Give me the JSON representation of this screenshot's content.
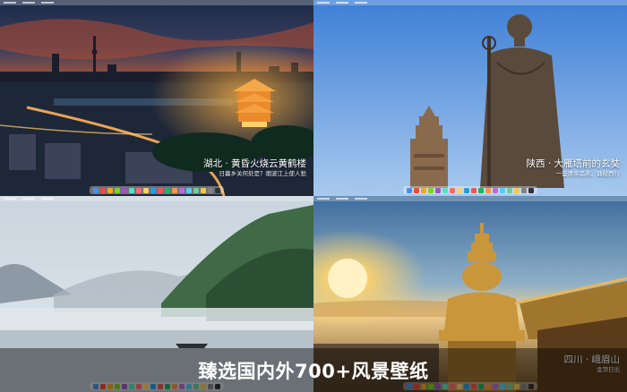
{
  "tiles": [
    {
      "title": "湖北 · 黄昏火烧云黄鹤楼",
      "subtitle": "日暮乡关何处是？烟波江上使人愁"
    },
    {
      "title": "陕西 · 大雁塔前的玄奘",
      "subtitle": "一壶清茶品茗，诵经西行"
    },
    {
      "title": "",
      "subtitle": ""
    },
    {
      "title": "四川 · 峨眉山",
      "subtitle": "金顶日出"
    }
  ],
  "banner": {
    "text": "臻选国内外700+风景壁纸"
  },
  "dock_colors": [
    "#4a90e2",
    "#e94b3c",
    "#f5a623",
    "#7ed321",
    "#9b59b6",
    "#50e3c2",
    "#ff6b6b",
    "#ffd166",
    "#2d9cdb",
    "#eb5757",
    "#27ae60",
    "#f2994a",
    "#bb6bd9",
    "#56ccf2",
    "#6fcf97",
    "#f2c94c",
    "#828282",
    "#333333"
  ]
}
